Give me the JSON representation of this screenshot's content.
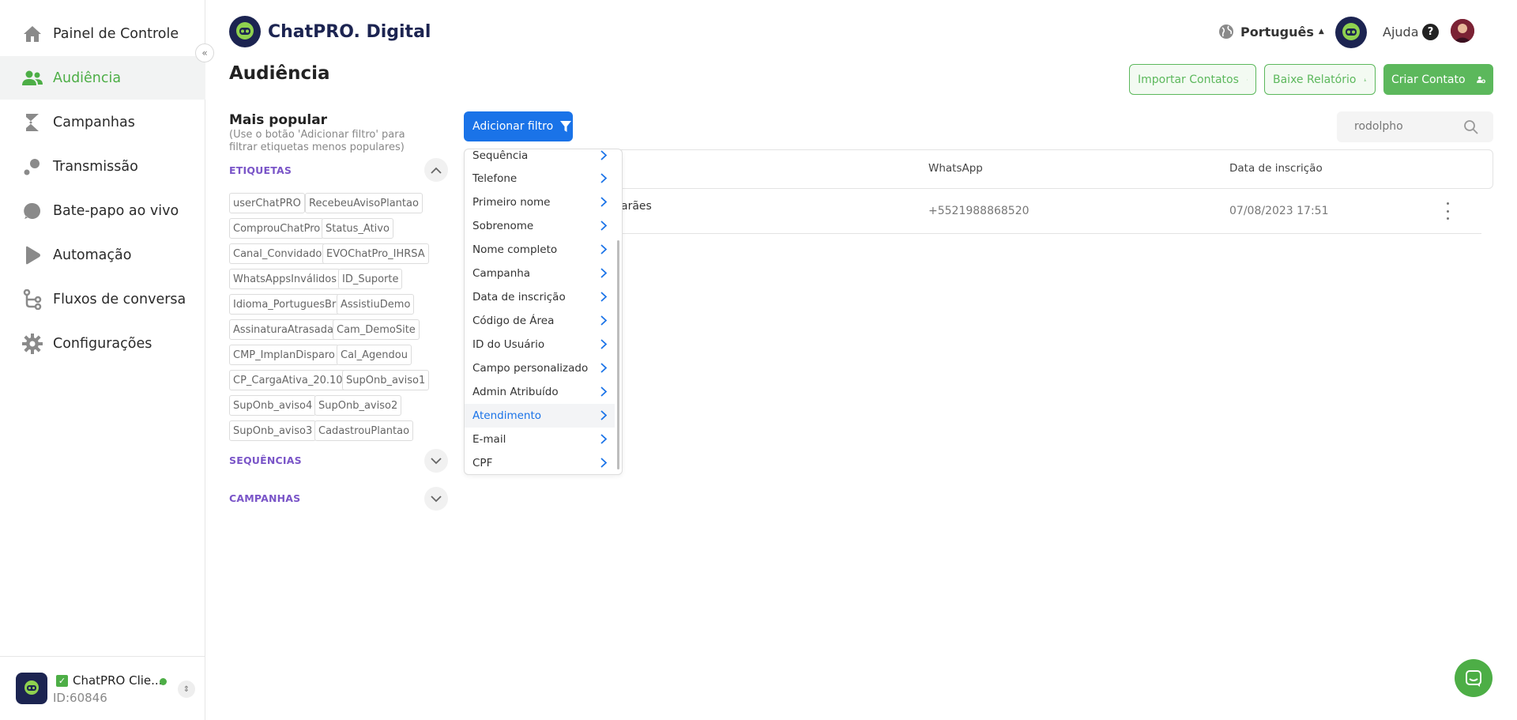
{
  "colors": {
    "accent_green": "#4dae46",
    "filter_blue": "#1a73e8",
    "section_purple": "#7a55c8",
    "brand_navy": "#1c2451"
  },
  "sidebar": {
    "items": [
      {
        "label": "Painel de Controle",
        "icon": "home-icon",
        "active": false
      },
      {
        "label": "Audiência",
        "icon": "audience-icon",
        "active": true
      },
      {
        "label": "Campanhas",
        "icon": "campaigns-icon",
        "active": false
      },
      {
        "label": "Transmissão",
        "icon": "broadcast-icon",
        "active": false
      },
      {
        "label": "Bate-papo ao vivo",
        "icon": "chat-bubble-icon",
        "active": false
      },
      {
        "label": "Automação",
        "icon": "play-icon",
        "active": false
      },
      {
        "label": "Fluxos de conversa",
        "icon": "flow-icon",
        "active": false
      },
      {
        "label": "Configurações",
        "icon": "gear-icon",
        "active": false
      }
    ],
    "account": {
      "name": "ChatPRO Clie...",
      "id": "ID:60846"
    }
  },
  "header": {
    "brand": "ChatPRO. Digital",
    "language": "Português",
    "help": "Ajuda"
  },
  "page": {
    "title": "Audiência",
    "buttons": {
      "import": "Importar Contatos",
      "report": "Baixe Relatório",
      "create": "Criar Contato"
    }
  },
  "filters": {
    "popular_title": "Mais popular",
    "popular_desc": "(Use o botão 'Adicionar filtro' para filtrar etiquetas menos populares)",
    "sections": {
      "tags": "ETIQUETAS",
      "sequences": "SEQUÊNCIAS",
      "campaigns": "CAMPANHAS"
    },
    "tags": [
      "userChatPRO",
      "RecebeuAvisoPlantao",
      "ComprouChatPro",
      "Status_Ativo",
      "Canal_Convidado",
      "EVOChatPro_IHRSA",
      "WhatsAppsInválidos",
      "ID_Suporte",
      "Idioma_PortuguesBr",
      "AssistiuDemo",
      "AssinaturaAtrasada",
      "Cam_DemoSite",
      "CMP_ImplanDisparo",
      "Cal_Agendou",
      "CP_CargaAtiva_20.10",
      "SupOnb_aviso1",
      "SupOnb_aviso4",
      "SupOnb_aviso2",
      "SupOnb_aviso3",
      "CadastrouPlantao"
    ],
    "add_filter": "Adicionar filtro",
    "dropdown": [
      "Sequência",
      "Telefone",
      "Primeiro nome",
      "Sobrenome",
      "Nome completo",
      "Campanha",
      "Data de inscrição",
      "Código de Área",
      "ID do Usuário",
      "Campo personalizado",
      "Admin Atribuído",
      "Atendimento",
      "E-mail",
      "CPF"
    ],
    "dropdown_highlighted": "Atendimento"
  },
  "search": {
    "value": "rodolpho"
  },
  "table": {
    "headers": {
      "whatsapp": "WhatsApp",
      "date": "Data de inscrição"
    },
    "rows": [
      {
        "name_fragment": "arães",
        "whatsapp": "+5521988868520",
        "date": "07/08/2023 17:51"
      }
    ]
  }
}
